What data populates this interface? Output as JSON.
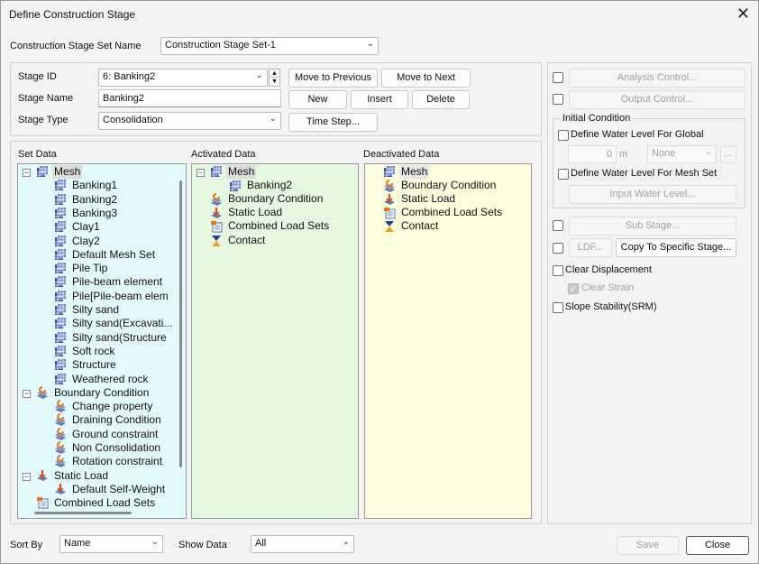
{
  "window": {
    "title": "Define Construction Stage"
  },
  "set_name": {
    "label": "Construction Stage Set Name",
    "value": "Construction Stage Set-1"
  },
  "stage": {
    "id_label": "Stage ID",
    "id_value": "6: Banking2",
    "name_label": "Stage Name",
    "name_value": "Banking2",
    "type_label": "Stage Type",
    "type_value": "Consolidation"
  },
  "buttons": {
    "move_prev": "Move to Previous",
    "move_next": "Move to Next",
    "new": "New",
    "insert": "Insert",
    "delete": "Delete",
    "time_step": "Time Step...",
    "save": "Save",
    "close": "Close"
  },
  "panels": {
    "set_data": "Set Data",
    "activated": "Activated Data",
    "deactivated": "Deactivated Data"
  },
  "set_tree": {
    "mesh": "Mesh",
    "mesh_items": [
      "Banking1",
      "Banking2",
      "Banking3",
      "Clay1",
      "Clay2",
      "Default Mesh Set",
      "Pile Tip",
      "Pile-beam element",
      "Pile[Pile-beam elem",
      "Silty sand",
      "Silty sand(Excavati...",
      "Silty sand(Structure",
      "Soft rock",
      "Structure",
      "Weathered rock"
    ],
    "boundary": "Boundary Condition",
    "boundary_items": [
      "Change property",
      "Draining Condition",
      "Ground constraint",
      "Non Consolidation",
      "Rotation constraint"
    ],
    "static": "Static Load",
    "static_items": [
      "Default Self-Weight"
    ],
    "combined": "Combined Load Sets"
  },
  "activated_tree": {
    "mesh": "Mesh",
    "mesh_child": "Banking2",
    "boundary": "Boundary Condition",
    "static": "Static Load",
    "combined": "Combined Load Sets",
    "contact": "Contact"
  },
  "deactivated_tree": {
    "mesh": "Mesh",
    "boundary": "Boundary Condition",
    "static": "Static Load",
    "combined": "Combined Load Sets",
    "contact": "Contact"
  },
  "right": {
    "analysis_control": "Analysis Control...",
    "output_control": "Output Control...",
    "initial_condition": "Initial Condition",
    "define_water_global": "Define Water Level For Global",
    "water_value": "0",
    "water_unit": "m",
    "water_select": "None",
    "ellipsis": "...",
    "define_water_mesh": "Define Water Level For Mesh Set",
    "input_water_level": "Input Water Level...",
    "sub_stage": "Sub Stage...",
    "ldf": "LDF...",
    "copy_to_stage": "Copy To Specific Stage...",
    "clear_displacement": "Clear Displacement",
    "clear_strain": "Clear Strain",
    "slope_stability": "Slope Stability(SRM)"
  },
  "bottom": {
    "sort_by_label": "Sort By",
    "sort_by_value": "Name",
    "show_data_label": "Show Data",
    "show_data_value": "All"
  },
  "colors": {
    "set_bg": "#e2fafb",
    "activated_bg": "#e3f8df",
    "deactivated_bg": "#fdfde0",
    "mesh_icon": "#3b4fa8",
    "boundary_icon": "#e8741c",
    "static_icon": "#d74a1f"
  }
}
